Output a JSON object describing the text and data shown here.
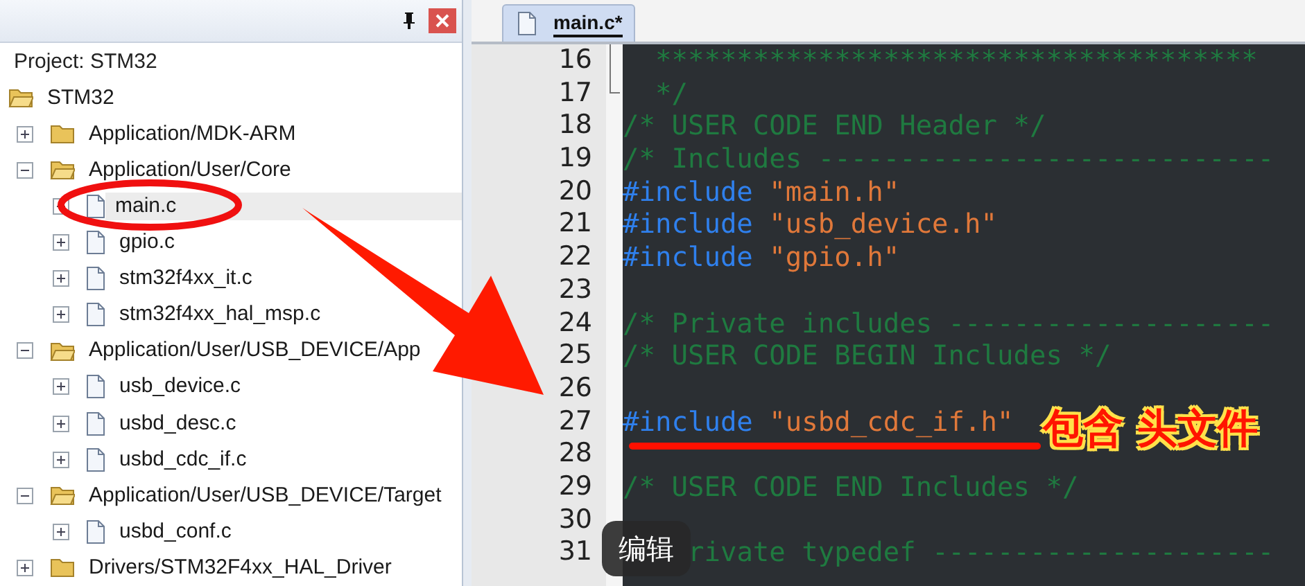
{
  "project_panel": {
    "title": "Project: STM32",
    "tree": [
      {
        "label": "STM32",
        "kind": "root",
        "expanded": true,
        "selected": false,
        "children": [
          {
            "label": "Application/MDK-ARM",
            "kind": "group",
            "expanded": false,
            "selected": false
          },
          {
            "label": "Application/User/Core",
            "kind": "group",
            "expanded": true,
            "selected": false,
            "children": [
              {
                "label": "main.c",
                "kind": "file",
                "expanded": false,
                "selected": true
              },
              {
                "label": "gpio.c",
                "kind": "file",
                "expanded": false,
                "selected": false
              },
              {
                "label": "stm32f4xx_it.c",
                "kind": "file",
                "expanded": false,
                "selected": false
              },
              {
                "label": "stm32f4xx_hal_msp.c",
                "kind": "file",
                "expanded": false,
                "selected": false
              }
            ]
          },
          {
            "label": "Application/User/USB_DEVICE/App",
            "kind": "group",
            "expanded": true,
            "selected": false,
            "children": [
              {
                "label": "usb_device.c",
                "kind": "file",
                "expanded": false,
                "selected": false
              },
              {
                "label": "usbd_desc.c",
                "kind": "file",
                "expanded": false,
                "selected": false
              },
              {
                "label": "usbd_cdc_if.c",
                "kind": "file",
                "expanded": false,
                "selected": false
              }
            ]
          },
          {
            "label": "Application/User/USB_DEVICE/Target",
            "kind": "group",
            "expanded": true,
            "selected": false,
            "children": [
              {
                "label": "usbd_conf.c",
                "kind": "file",
                "expanded": false,
                "selected": false
              }
            ]
          },
          {
            "label": "Drivers/STM32F4xx_HAL_Driver",
            "kind": "group",
            "expanded": false,
            "selected": false
          }
        ]
      }
    ]
  },
  "editor": {
    "tabs": [
      {
        "label": "main.c*",
        "selected": true
      }
    ],
    "lines": [
      {
        "number": "16",
        "tokens": [
          {
            "kind": "comment",
            "text": "  *************************************"
          }
        ]
      },
      {
        "number": "17",
        "tokens": [
          {
            "kind": "comment",
            "text": "  */"
          }
        ]
      },
      {
        "number": "18",
        "tokens": [
          {
            "kind": "comment",
            "text": "/* USER CODE END Header */"
          }
        ]
      },
      {
        "number": "19",
        "tokens": [
          {
            "kind": "comment",
            "text": "/* Includes ----------------------------"
          }
        ]
      },
      {
        "number": "20",
        "tokens": [
          {
            "kind": "directive",
            "text": "#include"
          },
          {
            "kind": "string",
            "text": "\"main.h\""
          }
        ]
      },
      {
        "number": "21",
        "tokens": [
          {
            "kind": "directive",
            "text": "#include"
          },
          {
            "kind": "string",
            "text": "\"usb_device.h\""
          }
        ]
      },
      {
        "number": "22",
        "tokens": [
          {
            "kind": "directive",
            "text": "#include"
          },
          {
            "kind": "string",
            "text": "\"gpio.h\""
          }
        ]
      },
      {
        "number": "23"
      },
      {
        "number": "24",
        "tokens": [
          {
            "kind": "comment",
            "text": "/* Private includes --------------------"
          }
        ]
      },
      {
        "number": "25",
        "tokens": [
          {
            "kind": "comment",
            "text": "/* USER CODE BEGIN Includes */"
          }
        ]
      },
      {
        "number": "26"
      },
      {
        "number": "27",
        "tokens": [
          {
            "kind": "directive",
            "text": "#include"
          },
          {
            "kind": "string",
            "text": "\"usbd_cdc_if.h\""
          }
        ]
      },
      {
        "number": "28"
      },
      {
        "number": "29",
        "tokens": [
          {
            "kind": "comment",
            "text": "/* USER CODE END Includes */"
          }
        ]
      },
      {
        "number": "30"
      },
      {
        "number": "31",
        "tokens": [
          {
            "kind": "comment",
            "text": "    rivate typedef ---------------------"
          }
        ]
      }
    ]
  },
  "annotation": {
    "note": "包含 头文件"
  },
  "overlay_button": {
    "label": "编辑"
  }
}
